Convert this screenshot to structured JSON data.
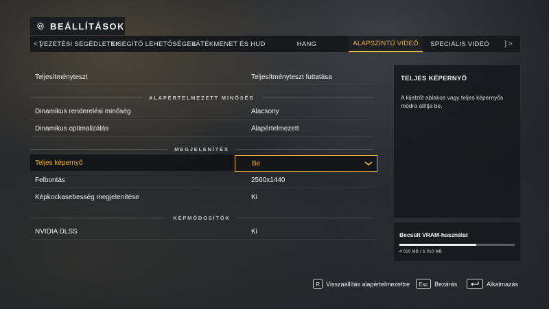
{
  "header": {
    "title": "BEÁLLÍTÁSOK",
    "icon": "gear-icon"
  },
  "tabs": {
    "prev": "< [",
    "next": "] >",
    "items": [
      {
        "label": "VEZETÉSI SEGÉDLETEK"
      },
      {
        "label": "KISEGÍTŐ LEHETŐSÉGEK"
      },
      {
        "label": "JÁTÉKMENET ÉS HUD"
      },
      {
        "label": "HANG"
      },
      {
        "label": "ALAPSZINTŰ VIDEÓ"
      },
      {
        "label": "SPECIÁLIS VIDEÓ"
      }
    ],
    "active_index": 4
  },
  "settings": {
    "benchmark": {
      "label": "Teljesítményteszt",
      "value": "Teljesítményteszt futtatása"
    },
    "section_quality": "ALAPÉRTELMEZETT MINŐSÉG",
    "dynamic_render": {
      "label": "Dinamikus renderelési minőség",
      "value": "Alacsony"
    },
    "dynamic_opt": {
      "label": "Dinamikus optimalizálás",
      "value": "Alapértelmezett"
    },
    "section_display": "MEGJELENÍTÉS",
    "fullscreen": {
      "label": "Teljes képernyő",
      "value": "Be"
    },
    "resolution": {
      "label": "Felbontás",
      "value": "2560x1440"
    },
    "fps_display": {
      "label": "Képkockasebesség megjelenítése",
      "value": "Ki"
    },
    "section_upscale": "KÉPMÓDOSÍTÓK",
    "dlss": {
      "label": "NVIDIA DLSS",
      "value": "Ki"
    }
  },
  "info": {
    "title": "TELJES KÉPERNYŐ",
    "description": "A kijelzőt ablakos vagy teljes képernyős módra állítja be."
  },
  "vram": {
    "title": "Becsült VRAM-használat",
    "text": "4 010 MB / 6 010 MB",
    "fraction": 0.667
  },
  "footer": {
    "reset_key": "R",
    "reset_label": "Visszaállítás alapértelmezettre",
    "close_key": "Esc",
    "close_label": "Bezárás",
    "apply_label": "Alkalmazás"
  },
  "colors": {
    "accent": "#f2b23d",
    "panel": "#17191d"
  }
}
